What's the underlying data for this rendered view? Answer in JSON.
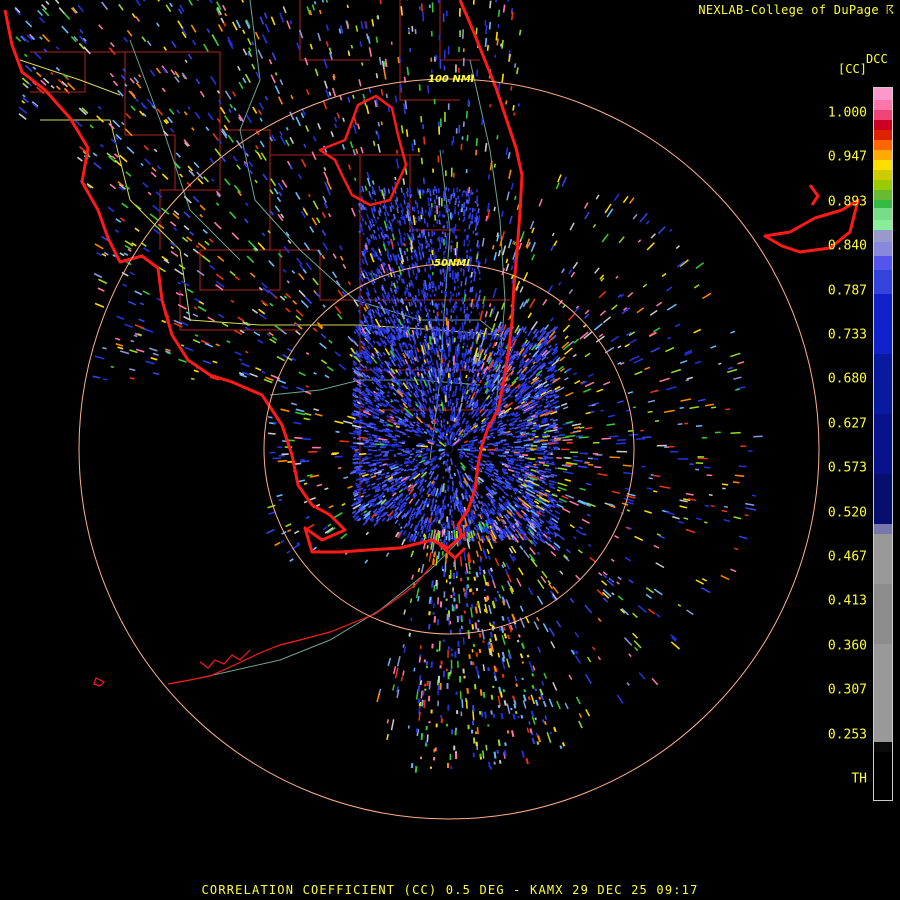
{
  "header": {
    "credit": "NEXLAB-College of DuPage ☈"
  },
  "legend": {
    "product_code": "DCC",
    "units": "[CC]",
    "ticks": [
      "1.000",
      "0.947",
      "0.893",
      "0.840",
      "0.787",
      "0.733",
      "0.680",
      "0.627",
      "0.573",
      "0.520",
      "0.467",
      "0.413",
      "0.360",
      "0.307",
      "0.253",
      "TH"
    ]
  },
  "range_rings": {
    "inner_label": "50NMI",
    "outer_label": "100 NMI"
  },
  "footer": {
    "caption": "CORRELATION COEFFICIENT (CC) 0.5 DEG - KAMX 29 DEC 25 09:17"
  },
  "colors": {
    "coast": "#ff1a1a",
    "ring": "#ffb08a",
    "county": "#b22222",
    "highway": "#88ccbb",
    "state_line": "#ffff66",
    "radar_site": "#000000"
  }
}
